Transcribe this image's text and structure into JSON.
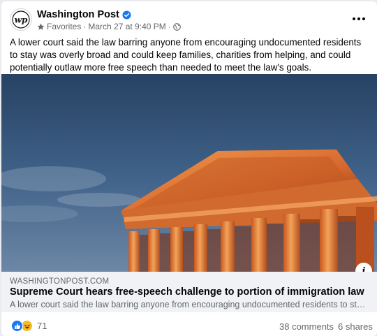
{
  "post": {
    "page_name": "Washington Post",
    "avatar_text": "wp",
    "favorites_label": "Favorites",
    "separator": "·",
    "timestamp": "March 27 at 9:40 PM",
    "text": "A lower court said the law barring anyone from encouraging undocumented residents to stay was overly broad and could keep families, charities from helping, and could potentially outlaw more free speech than needed to meet the law's goals."
  },
  "link_preview": {
    "domain": "WASHINGTONPOST.COM",
    "title": "Supreme Court hears free-speech challenge to portion of immigration law",
    "description": "A lower court said the law barring anyone from encouraging undocumented residents to stay was overly broad and could keep families, charities from helping."
  },
  "engagement": {
    "reaction_count": "71",
    "comments": "38 comments",
    "shares": "6 shares"
  },
  "icons": {
    "verified": "verified-badge-icon",
    "audience": "globe-icon",
    "favorite": "star-icon",
    "more": "more-options-icon",
    "info": "info-icon",
    "reactions": [
      "like-icon",
      "haha-icon"
    ]
  },
  "colors": {
    "accent": "#1877f2",
    "haha": "#f7b928",
    "secondary_text": "#65676b",
    "link_box_bg": "#f0f2f5"
  }
}
